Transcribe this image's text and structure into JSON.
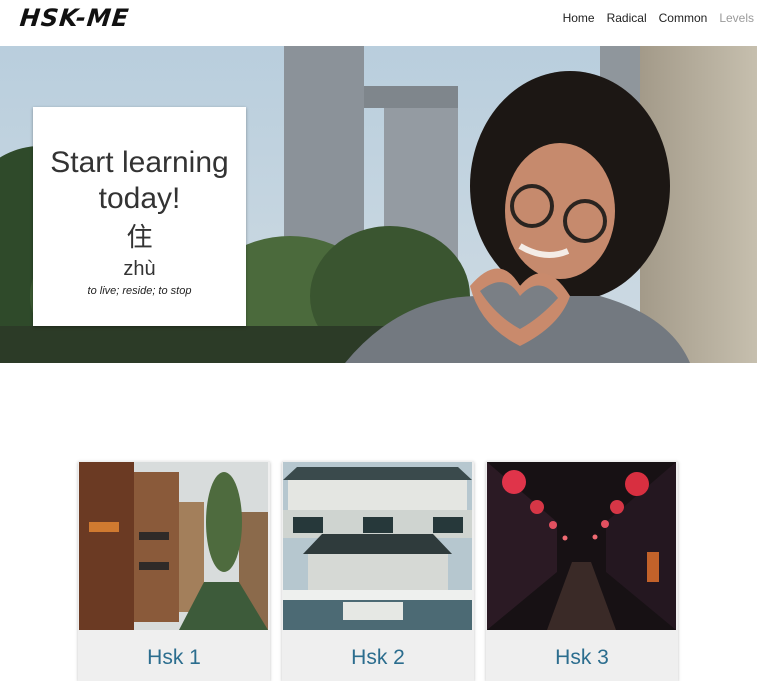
{
  "brand": {
    "name": "HSK-ME"
  },
  "nav": {
    "items": [
      {
        "label": "Home"
      },
      {
        "label": "Radical"
      },
      {
        "label": "Common"
      },
      {
        "label": "Levels"
      }
    ]
  },
  "hero": {
    "title": "Start learning today!",
    "character": "住",
    "pinyin": "zhù",
    "meaning": "to live; reside; to stop"
  },
  "levels": [
    {
      "label": "Hsk 1"
    },
    {
      "label": "Hsk 2"
    },
    {
      "label": "Hsk 3"
    }
  ],
  "colors": {
    "level_label": "#2b6d8e",
    "nav_muted": "#9a9a9a"
  }
}
